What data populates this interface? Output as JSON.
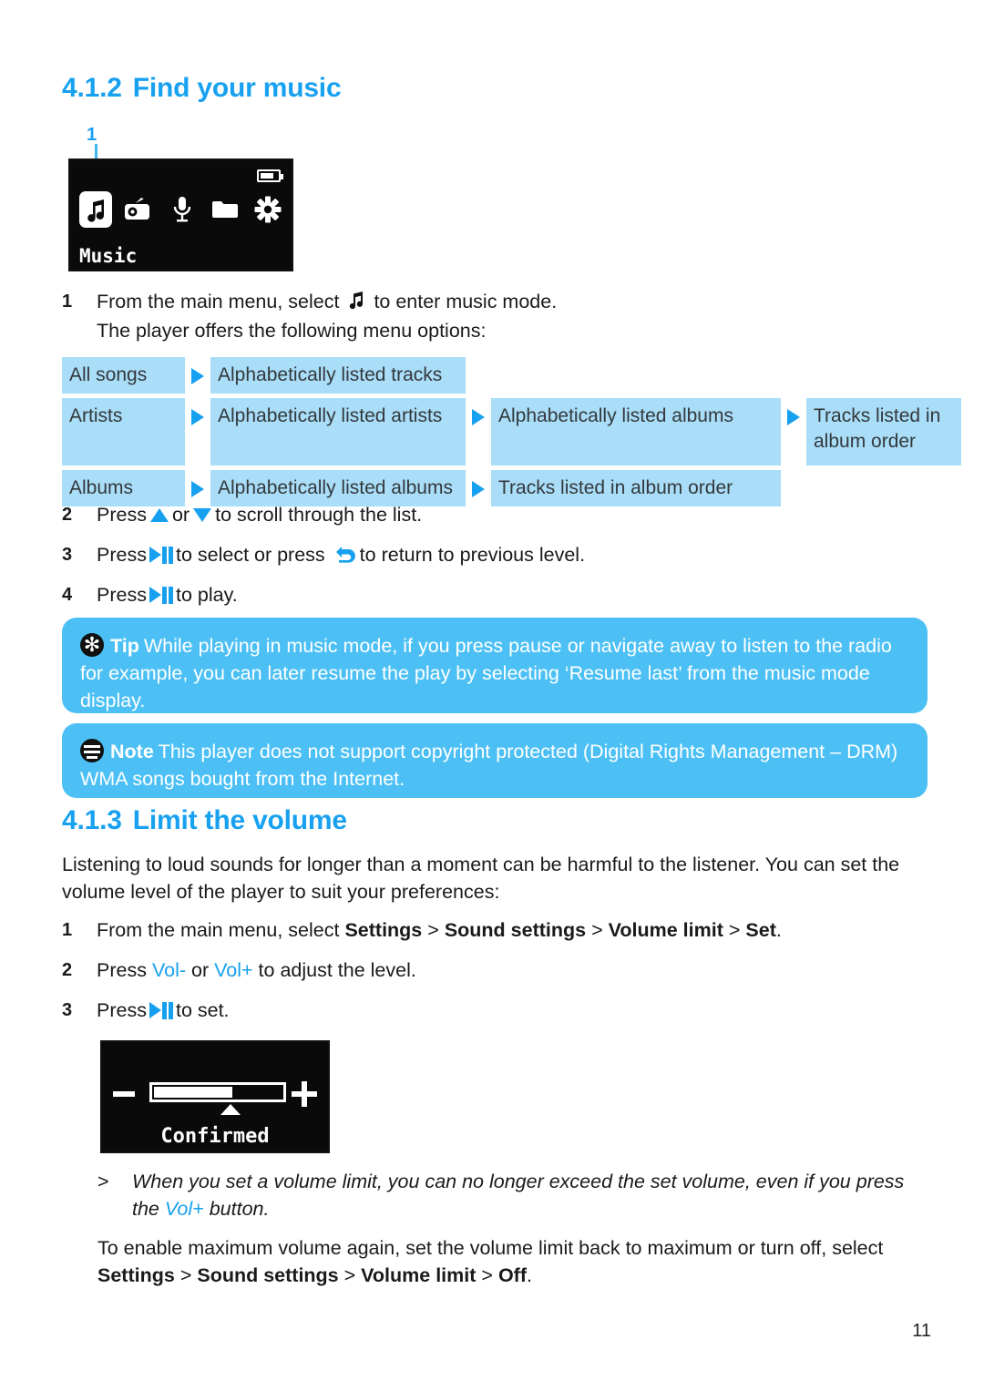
{
  "document": {
    "page_number": "11"
  },
  "sections": {
    "find_music": {
      "number": "4.1.2",
      "title": "Find your music",
      "callout_label": "1",
      "device_screen": {
        "selected_label": "Music",
        "icons": [
          "music-note-icon",
          "radio-icon",
          "microphone-icon",
          "folder-icon",
          "settings-gear-icon"
        ],
        "battery": "battery-icon"
      },
      "steps": [
        {
          "n": "1",
          "text_before": "From the main menu, select",
          "icon": "music-note-icon",
          "text_after": "to enter music mode.",
          "line2": "The player offers the following menu options:"
        },
        {
          "n": "2",
          "text_before": "Press",
          "icon1": "arrow-up-icon",
          "text_mid": "or",
          "icon2": "arrow-down-icon",
          "text_after": "to scroll through the list."
        },
        {
          "n": "3",
          "text_before": "Press",
          "icon1": "play-pause-icon",
          "text_mid": "to select or press",
          "icon2": "back-arrow-icon",
          "text_after": "to return to previous level."
        },
        {
          "n": "4",
          "text_before": "Press",
          "icon1": "play-pause-icon",
          "text_after": "to play."
        }
      ],
      "menu_table": {
        "rows": [
          {
            "level1": "All songs",
            "level2": "Alphabetically listed tracks",
            "level3": null,
            "level4": null
          },
          {
            "level1": "Artists",
            "level2": "Alphabetically listed artists",
            "level3": "Alphabetically listed albums",
            "level4": "Tracks listed in album order"
          },
          {
            "level1": "Albums",
            "level2": "Alphabetically listed albums",
            "level3": "Tracks listed in album order",
            "level4": null
          }
        ]
      },
      "tip": {
        "lead": "Tip",
        "icon": "tip-asterisk-icon",
        "text": "While playing in music mode, if you press pause or navigate away to listen to the radio for example, you can later resume the play by selecting ‘Resume last’ from the music mode display."
      },
      "note": {
        "lead": "Note",
        "icon": "note-lines-icon",
        "text": "This player does not support copyright protected (Digital Rights Management – DRM) WMA songs bought from the Internet."
      }
    },
    "limit_volume": {
      "number": "4.1.3",
      "title": "Limit the volume",
      "intro": "Listening to loud sounds for longer than a moment can be harmful to the listener. You can set the volume level of the player to suit your preferences:",
      "steps": [
        {
          "n": "1",
          "text_before": "From the main menu, select",
          "path": [
            "Settings",
            "Sound settings",
            "Volume limit",
            "Set"
          ],
          "separator": ">",
          "text_after": "."
        },
        {
          "n": "2",
          "text_before": "Press",
          "key1": "Vol-",
          "text_mid": "or",
          "key2": "Vol+",
          "text_after": "to adjust the level."
        },
        {
          "n": "3",
          "text_before": "Press",
          "icon1": "play-pause-icon",
          "text_after": "to set."
        }
      ],
      "device_screen": {
        "minus": "minus-icon",
        "plus": "plus-icon",
        "status": "Confirmed",
        "volume_percent": 60
      },
      "result": {
        "marker": ">",
        "text_before": "When you set a volume limit, you can no longer exceed the set volume, even if you press the",
        "key": "Vol+",
        "text_after": "button."
      },
      "closing": {
        "line1": "To enable maximum volume again, set the volume limit back to maximum or turn off,",
        "line2_before": "select",
        "path": [
          "Settings",
          "Sound settings",
          "Volume limit",
          "Off"
        ],
        "separator": ">",
        "line2_after": "."
      }
    }
  },
  "colors": {
    "heading_blue": "#18a1f0",
    "callout_blue": "#4cc0f5",
    "table_cell_blue": "#a9ddf8",
    "accent_blue": "#17a0ef",
    "screen_black": "#0a0a0a"
  }
}
